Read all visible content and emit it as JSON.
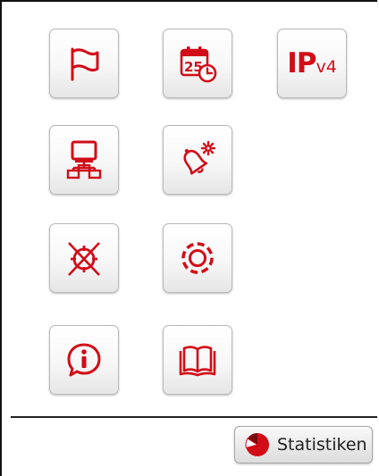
{
  "accent_color": "#d10d18",
  "tiles": [
    {
      "icon": "flag-icon"
    },
    {
      "icon": "calendar-clock-icon",
      "text": "25"
    },
    {
      "icon": "ipv4-icon",
      "text_main": "IP",
      "text_sub": "v4"
    },
    {
      "icon": "network-computer-icon"
    },
    {
      "icon": "alarm-bell-settings-icon"
    },
    {
      "icon": "crossed-target-icon"
    },
    {
      "icon": "dashed-circle-icon"
    },
    {
      "icon": "info-icon"
    },
    {
      "icon": "open-book-icon"
    }
  ],
  "footer": {
    "statistics_button": {
      "icon": "pie-chart-icon",
      "label": "Statistiken"
    }
  }
}
